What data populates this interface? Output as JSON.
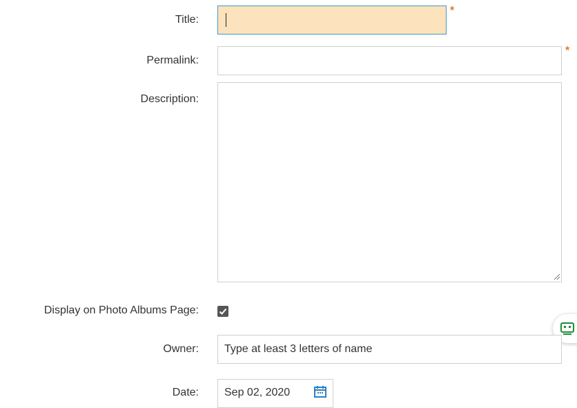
{
  "form": {
    "title_label": "Title:",
    "title_value": "",
    "permalink_label": "Permalink:",
    "permalink_value": "",
    "description_label": "Description:",
    "description_value": "",
    "display_label": "Display on Photo Albums Page:",
    "display_checked": true,
    "owner_label": "Owner:",
    "owner_placeholder": "Type at least 3 letters of name",
    "date_label": "Date:",
    "date_value": "Sep 02, 2020",
    "required_marker": "*"
  },
  "icons": {
    "calendar": "calendar-icon",
    "side_widget": "chat-robot-icon",
    "resize": "resize-handle-icon"
  },
  "colors": {
    "required": "#e07b26",
    "title_bg": "#fde3bd",
    "title_border": "#3e97c9",
    "accent_green": "#1e8b3a",
    "calendar_blue": "#2b7fc1"
  }
}
